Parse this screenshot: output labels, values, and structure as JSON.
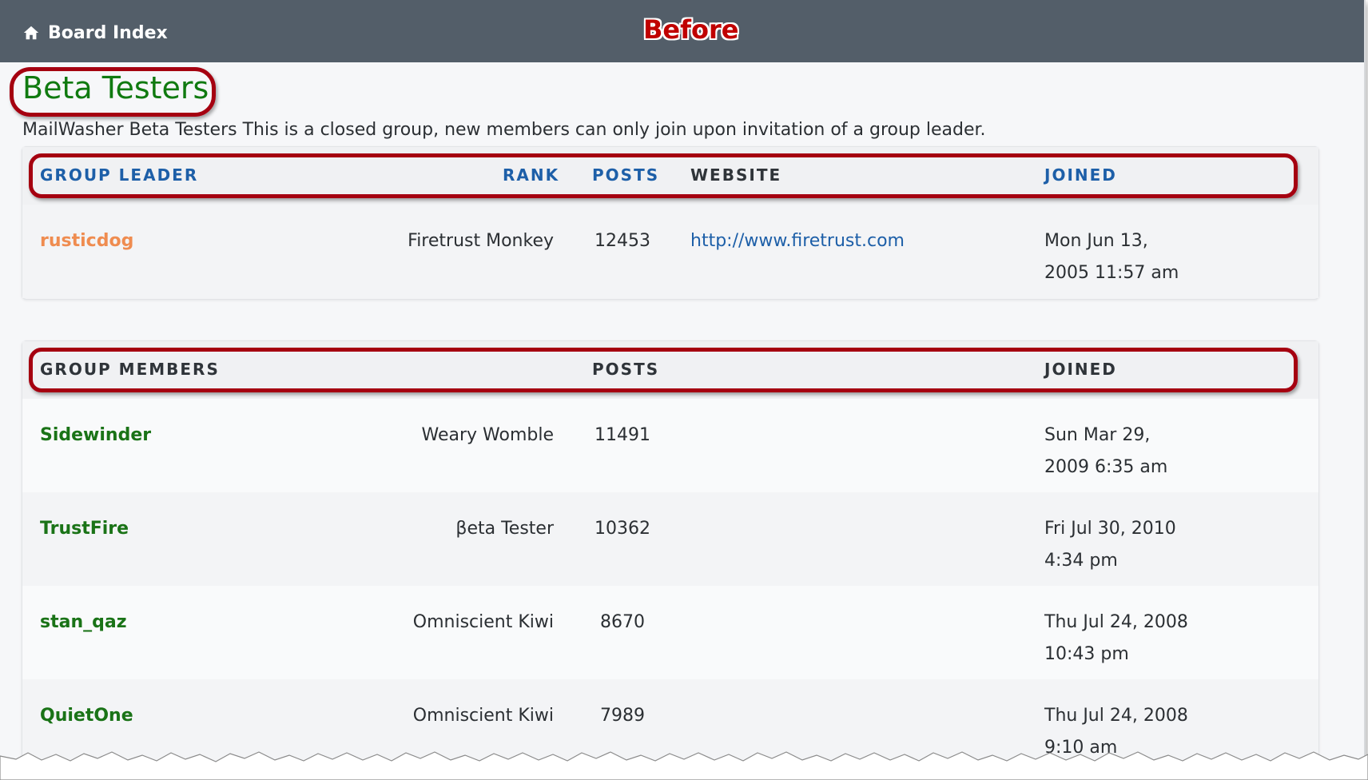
{
  "header": {
    "nav_label": "Board Index",
    "annotation": "Before"
  },
  "group": {
    "title": "Beta Testers",
    "description": "MailWasher Beta Testers This is a closed group, new members can only join upon invitation of a group leader."
  },
  "leader_table": {
    "headers": {
      "leader": "GROUP LEADER",
      "rank": "RANK",
      "posts": "POSTS",
      "website": "WEBSITE",
      "joined": "JOINED"
    },
    "rows": [
      {
        "name": "rusticdog",
        "rank": "Firetrust Monkey",
        "posts": "12453",
        "website": "http://www.firetrust.com",
        "joined_line1": "Mon Jun 13,",
        "joined_line2": "2005 11:57 am"
      }
    ]
  },
  "members_table": {
    "headers": {
      "members": "GROUP MEMBERS",
      "posts": "POSTS",
      "joined": "JOINED"
    },
    "rows": [
      {
        "name": "Sidewinder",
        "rank": "Weary Womble",
        "posts": "11491",
        "joined_line1": "Sun Mar 29,",
        "joined_line2": "2009 6:35 am"
      },
      {
        "name": "TrustFire",
        "rank": "βeta Tester",
        "posts": "10362",
        "joined_line1": "Fri Jul 30, 2010",
        "joined_line2": "4:34 pm"
      },
      {
        "name": "stan_qaz",
        "rank": "Omniscient Kiwi",
        "posts": "8670",
        "joined_line1": "Thu Jul 24, 2008",
        "joined_line2": "10:43 pm"
      },
      {
        "name": "QuietOne",
        "rank": "Omniscient Kiwi",
        "posts": "7989",
        "joined_line1": "Thu Jul 24, 2008",
        "joined_line2": "9:10 am"
      }
    ]
  },
  "colors": {
    "topbar": "#535e69",
    "title_green": "#107a10",
    "leader_orange": "#ef8c50",
    "member_green": "#1a7317",
    "link_blue": "#1d5fa8",
    "annotation_red": "#a50010"
  },
  "icons": {
    "nav": "home-icon"
  }
}
